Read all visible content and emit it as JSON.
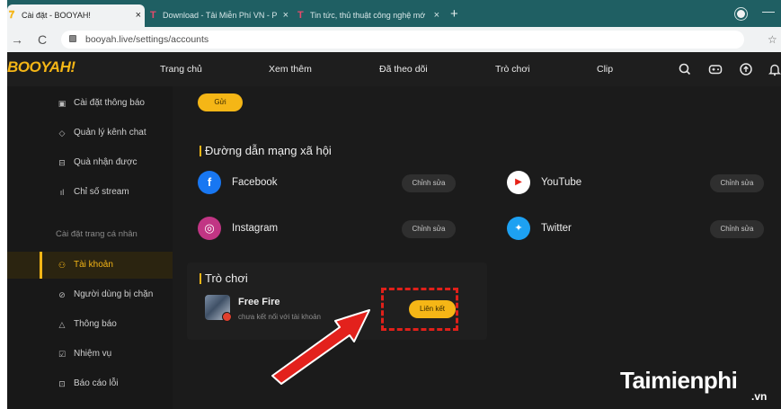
{
  "browser": {
    "tabs": [
      {
        "title": "Cài đặt - BOOYAH!",
        "favicon": "booyah-logo-icon",
        "active": true
      },
      {
        "title": "Download - Tải Miễn Phí VN - P",
        "favicon": "taimienphi-t-icon",
        "active": false
      },
      {
        "title": "Tin tức, thủ thuật công nghệ mớ",
        "favicon": "taimienphi-t-icon",
        "active": false
      }
    ],
    "tab_close_glyph": "×",
    "new_tab_glyph": "+",
    "url": "booyah.live/settings/accounts"
  },
  "app": {
    "logo_text": "BOOYAH!",
    "nav": [
      "Trang chủ",
      "Xem thêm",
      "Đã theo dõi",
      "Trò chơi",
      "Clip"
    ],
    "nav_icons": [
      "search-icon",
      "gamepad-icon",
      "upload-icon",
      "notification-bell-icon"
    ]
  },
  "sidebar": {
    "items_top": [
      {
        "label": "Cài đặt thông báo",
        "icon": "notification-settings-icon"
      },
      {
        "label": "Quản lý kênh chat",
        "icon": "shield-icon"
      },
      {
        "label": "Quà nhận được",
        "icon": "gift-icon"
      },
      {
        "label": "Chỉ số stream",
        "icon": "bar-chart-icon"
      }
    ],
    "section_title": "Cài đặt trang cá nhân",
    "items_bottom": [
      {
        "label": "Tài khoản",
        "icon": "user-account-icon",
        "active": true
      },
      {
        "label": "Người dùng bị chặn",
        "icon": "blocked-user-icon"
      },
      {
        "label": "Thông báo",
        "icon": "bell-icon"
      },
      {
        "label": "Nhiệm vụ",
        "icon": "mission-icon"
      },
      {
        "label": "Báo cáo lỗi",
        "icon": "report-icon"
      }
    ]
  },
  "main": {
    "submit_label": "Gửi",
    "social_heading": "Đường dẫn mạng xã hội",
    "social": [
      {
        "name": "Facebook",
        "edit_label": "Chỉnh sửa",
        "color": "#1877f2",
        "glyph": "f"
      },
      {
        "name": "YouTube",
        "edit_label": "Chỉnh sửa",
        "color": "#ff0000",
        "glyph": "▶"
      },
      {
        "name": "Instagram",
        "edit_label": "Chỉnh sửa",
        "color": "#c13584",
        "glyph": "◎"
      },
      {
        "name": "Twitter",
        "edit_label": "Chỉnh sửa",
        "color": "#1da1f2",
        "glyph": "✦"
      }
    ],
    "games_heading": "Trò chơi",
    "game": {
      "name": "Free Fire",
      "status": "chưa kết nối với tài khoản",
      "link_label": "Liên kết"
    }
  },
  "colors": {
    "accent": "#f5b616",
    "highlight": "#e0201a"
  },
  "watermark": {
    "brand": "Taimienphi",
    "tld": ".vn"
  }
}
